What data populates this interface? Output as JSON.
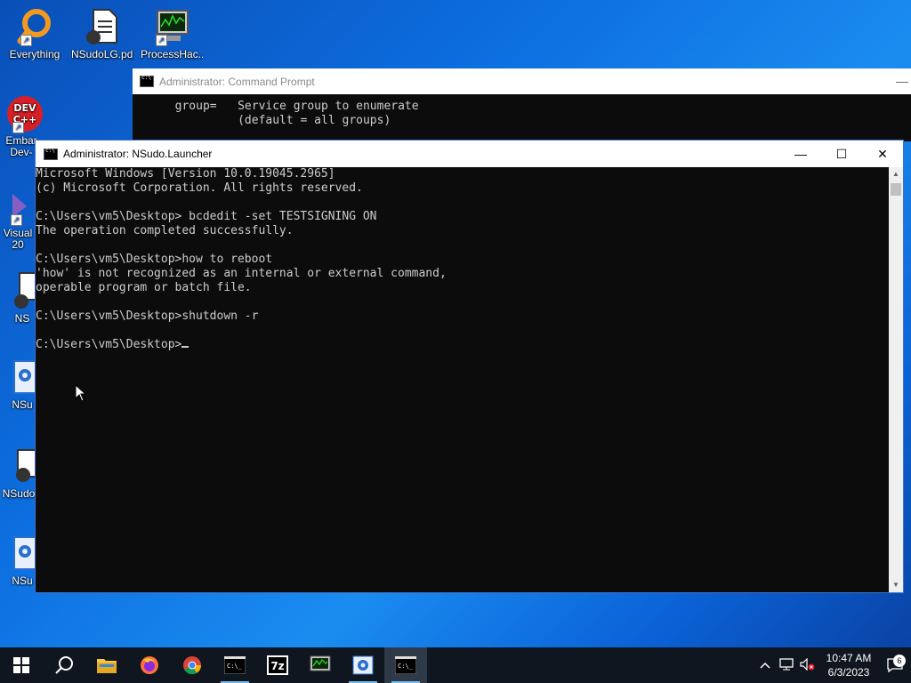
{
  "desktop": {
    "icons": [
      {
        "label": "Everything"
      },
      {
        "label": "NSudoLG.pdb"
      },
      {
        "label": "ProcessHac..."
      },
      {
        "label": "Embar Dev-"
      },
      {
        "label": "Visual 20"
      },
      {
        "label": "NS"
      },
      {
        "label": "NSu"
      },
      {
        "label": "NSudo"
      },
      {
        "label": "NSu"
      }
    ]
  },
  "back_window": {
    "title": "Administrator: Command Prompt",
    "lines": [
      "  group=   Service group to enumerate",
      "           (default = all groups)"
    ]
  },
  "front_window": {
    "title": "Administrator: NSudo.Launcher",
    "lines": [
      "Microsoft Windows [Version 10.0.19045.2965]",
      "(c) Microsoft Corporation. All rights reserved.",
      "",
      "C:\\Users\\vm5\\Desktop> bcdedit -set TESTSIGNING ON",
      "The operation completed successfully.",
      "",
      "C:\\Users\\vm5\\Desktop>how to reboot",
      "'how' is not recognized as an internal or external command,",
      "operable program or batch file.",
      "",
      "C:\\Users\\vm5\\Desktop>shutdown -r",
      ""
    ],
    "prompt": "C:\\Users\\vm5\\Desktop>"
  },
  "taskbar": {
    "apps": [
      "start",
      "search",
      "file-explorer",
      "firefox",
      "chrome",
      "command-prompt",
      "7zip",
      "process-hacker",
      "nsudo",
      "nsudo-launcher"
    ],
    "time": "10:47 AM",
    "date": "6/3/2023",
    "notification_count": "6"
  }
}
